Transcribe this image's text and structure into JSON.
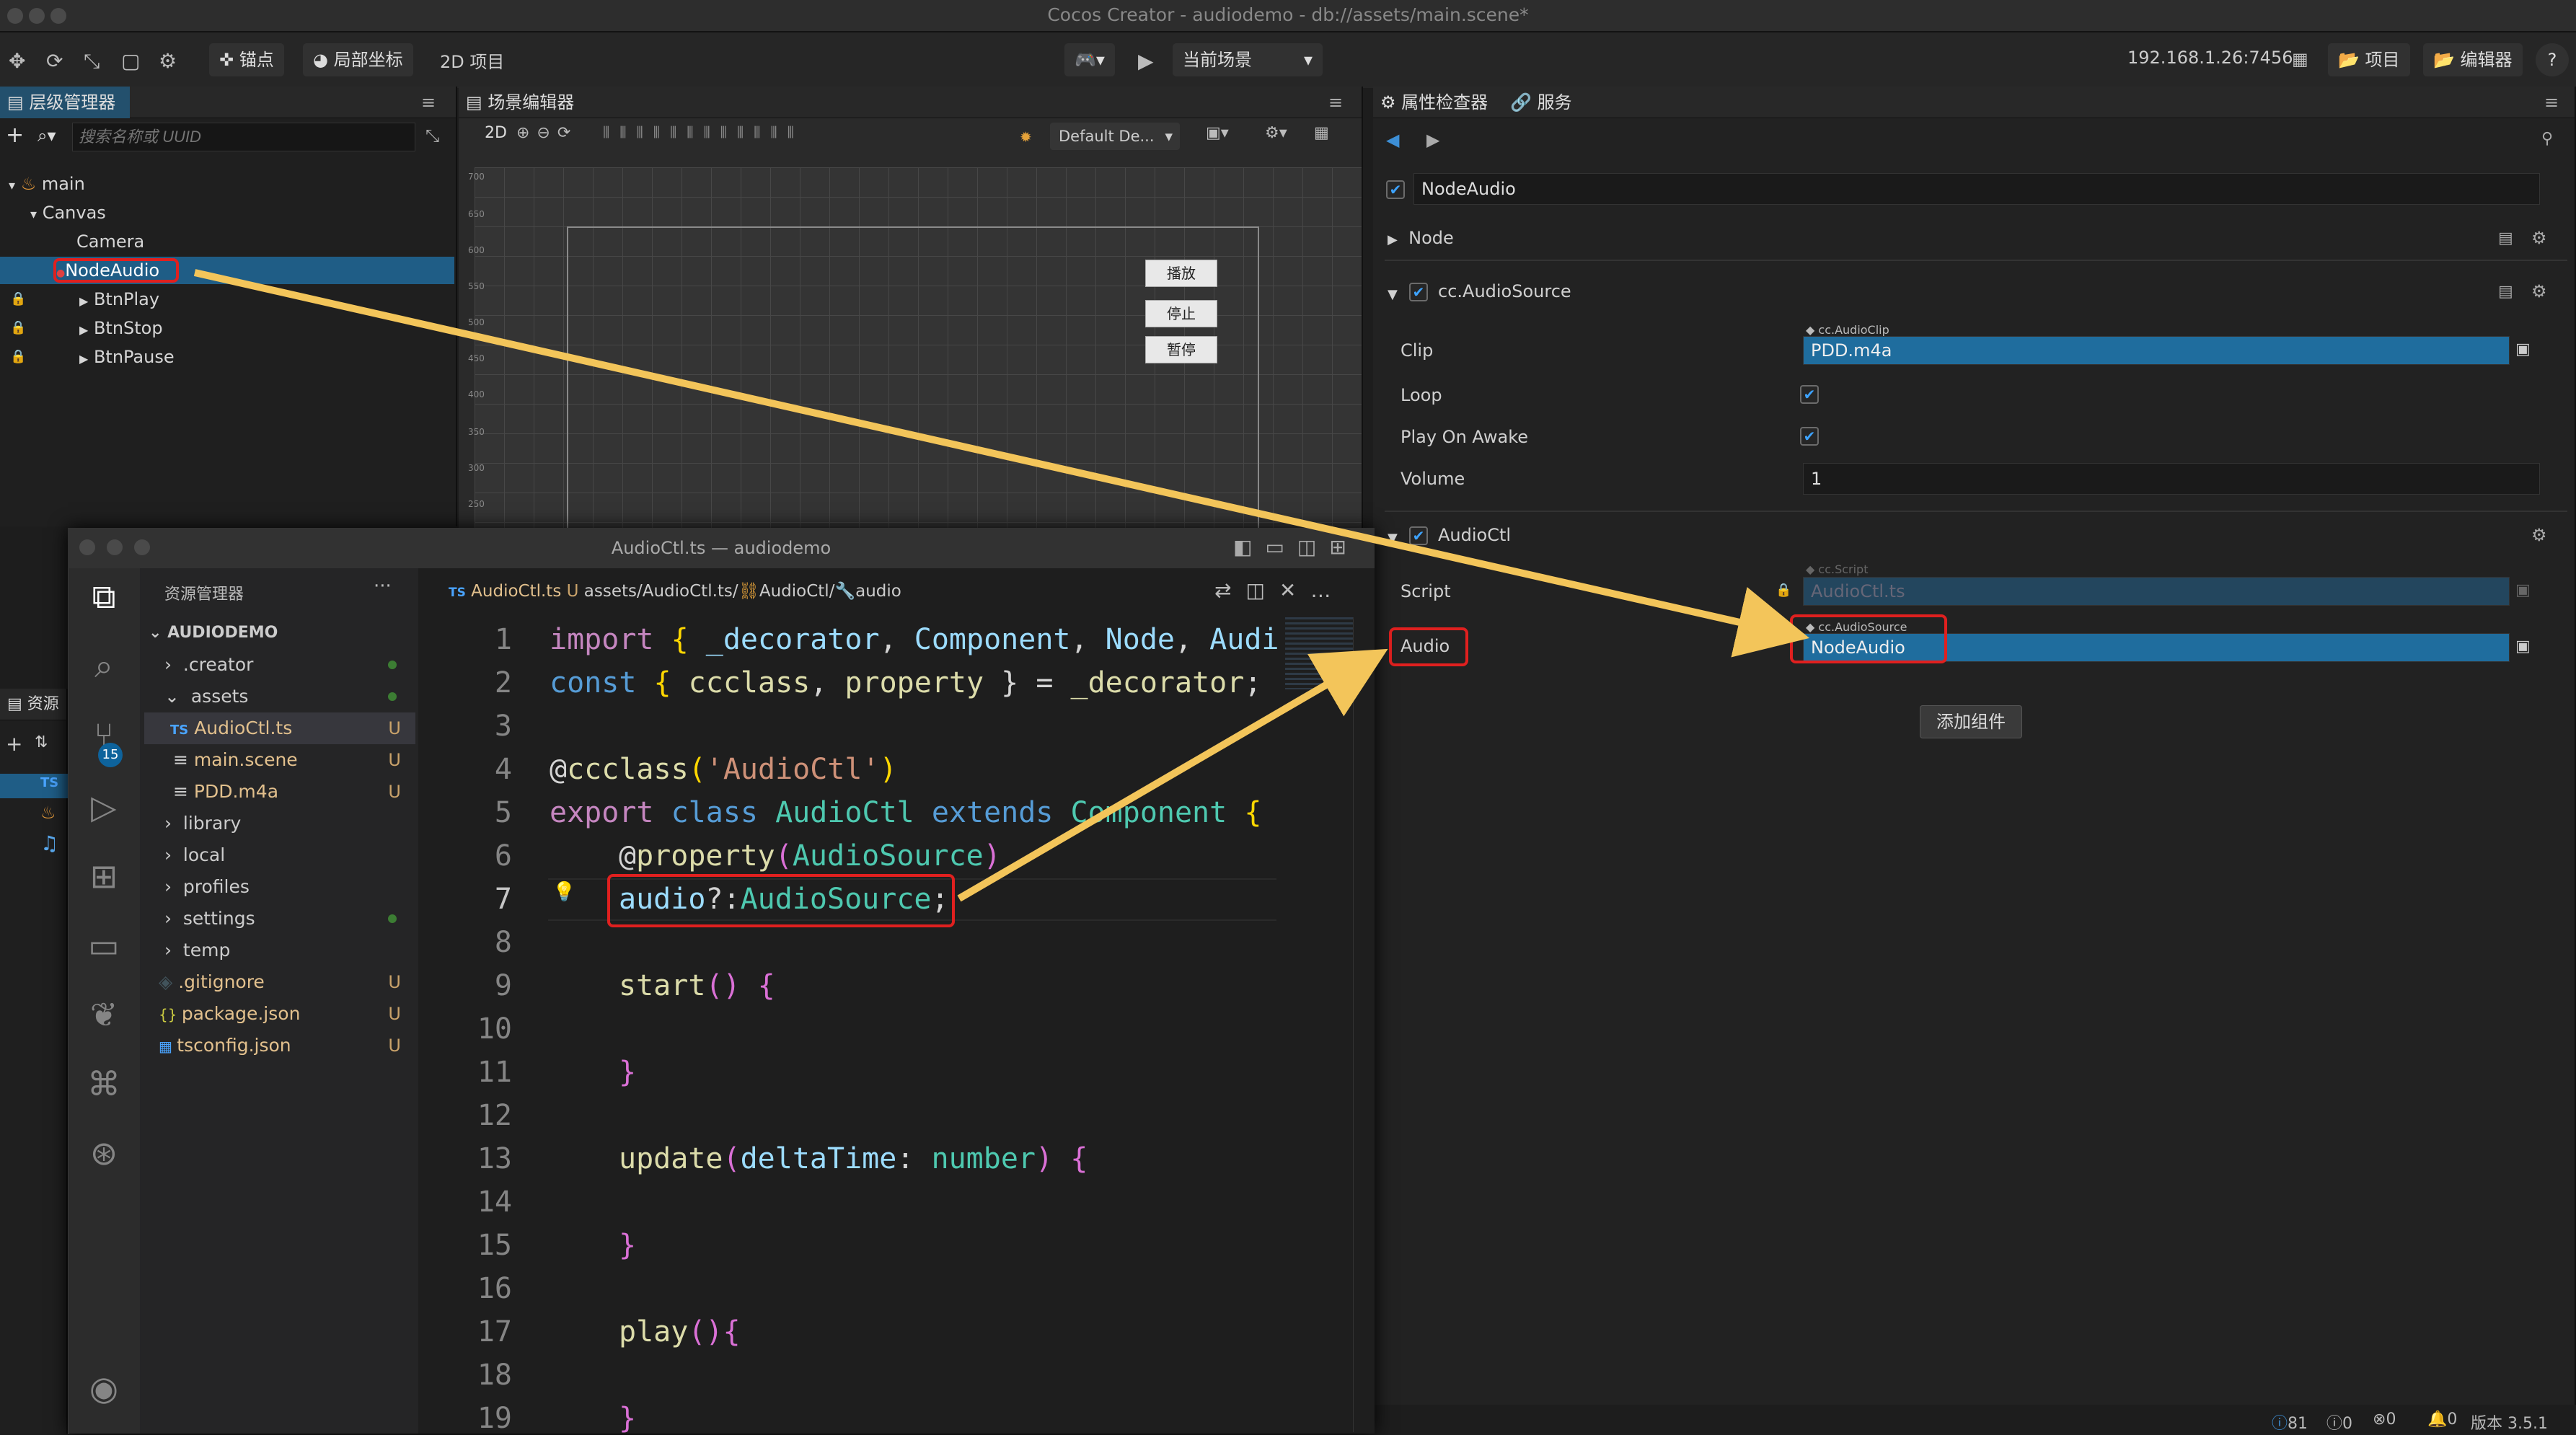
{
  "window_title": "Cocos Creator - audiodemo - db://assets/main.scene*",
  "toolbar": {
    "anchor": "锚点",
    "local_coord": "局部坐标",
    "project_2d": "2D 项目",
    "current_scene": "当前场景",
    "ip": "192.168.1.26:7456",
    "project_btn": "项目",
    "editor_btn": "编辑器",
    "help": "?"
  },
  "hierarchy": {
    "tab": "层级管理器",
    "search_placeholder": "搜索名称或 UUID",
    "items": [
      {
        "label": "main"
      },
      {
        "label": "Canvas"
      },
      {
        "label": "Camera"
      },
      {
        "label": "NodeAudio"
      },
      {
        "label": "BtnPlay"
      },
      {
        "label": "BtnStop"
      },
      {
        "label": "BtnPause"
      }
    ]
  },
  "assets_panel": {
    "tab": "资源"
  },
  "scene": {
    "tab": "场景编辑器",
    "mode": "2D",
    "camera": "Default De...",
    "ruler": [
      "700",
      "650",
      "600",
      "550",
      "500",
      "450",
      "400",
      "350",
      "300",
      "250"
    ],
    "buttons": [
      "播放",
      "停止",
      "暂停"
    ]
  },
  "inspector": {
    "tab": "属性检查器",
    "tab2": "服务",
    "node_name": "NodeAudio",
    "node_section": "Node",
    "audio_source": {
      "title": "cc.AudioSource",
      "clip_label": "Clip",
      "clip_type": "cc.AudioClip",
      "clip_value": "PDD.m4a",
      "loop_label": "Loop",
      "play_on_awake_label": "Play On Awake",
      "volume_label": "Volume",
      "volume_value": "1"
    },
    "audioctl": {
      "title": "AudioCtl",
      "script_label": "Script",
      "script_type": "cc.Script",
      "script_value": "AudioCtl.ts",
      "audio_label": "Audio",
      "audio_type": "cc.AudioSource",
      "audio_value": "NodeAudio"
    },
    "add_component": "添加组件"
  },
  "vscode": {
    "title": "AudioCtl.ts — audiodemo",
    "explorer_title": "资源管理器",
    "root": "AUDIODEMO",
    "badge": "15",
    "files": [
      {
        "name": ".creator",
        "status": ""
      },
      {
        "name": "assets",
        "status": ""
      },
      {
        "name": "AudioCtl.ts",
        "status": "U"
      },
      {
        "name": "main.scene",
        "status": "U"
      },
      {
        "name": "PDD.m4a",
        "status": "U"
      },
      {
        "name": "library",
        "status": ""
      },
      {
        "name": "local",
        "status": ""
      },
      {
        "name": "profiles",
        "status": ""
      },
      {
        "name": "settings",
        "status": ""
      },
      {
        "name": "temp",
        "status": ""
      },
      {
        "name": ".gitignore",
        "status": "U"
      },
      {
        "name": "package.json",
        "status": "U"
      },
      {
        "name": "tsconfig.json",
        "status": "U"
      }
    ],
    "tab_file": "AudioCtl.ts",
    "tab_status": "U",
    "breadcrumb": "assets/AudioCtl.ts/",
    "breadcrumb_class": "AudioCtl/",
    "breadcrumb_prop": "audio",
    "line_numbers": [
      "1",
      "2",
      "3",
      "4",
      "5",
      "6",
      "7",
      "8",
      "9",
      "10",
      "11",
      "12",
      "13",
      "14",
      "15",
      "16",
      "17",
      "18",
      "19"
    ],
    "code": {
      "l1a": "import",
      "l1b": " { ",
      "l1c": "_decorator",
      "l1d": ", ",
      "l1e": "Component",
      "l1f": ", ",
      "l1g": "Node",
      "l1h": ", ",
      "l1i": "Audi",
      "l2a": "const",
      "l2b": " { ",
      "l2c": "ccclass",
      "l2d": ", ",
      "l2e": "property",
      "l2f": " } = ",
      "l2g": "_decorator",
      "l2h": ";",
      "l4a": "@",
      "l4b": "ccclass",
      "l4c": "(",
      "l4d": "'AudioCtl'",
      "l4e": ")",
      "l5a": "export",
      "l5b": " class ",
      "l5c": "AudioCtl",
      "l5d": " extends ",
      "l5e": "Component",
      "l5f": " {",
      "l6a": "@",
      "l6b": "property",
      "l6c": "(",
      "l6d": "AudioSource",
      "l6e": ")",
      "l7a": "audio",
      "l7b": "?:",
      "l7c": "AudioSource",
      "l7d": ";",
      "l9a": "start",
      "l9b": "() ",
      "l9c": "{",
      "l11": "}",
      "l13a": "update",
      "l13b": "(",
      "l13c": "deltaTime",
      "l13d": ": ",
      "l13e": "number",
      "l13f": ") ",
      "l13g": "{",
      "l15": "}",
      "l17a": "play",
      "l17b": "(){",
      "l19": "}"
    }
  },
  "status": {
    "info": "81",
    "warn": "0",
    "err": "0",
    "bell": "0",
    "version": "版本 3.5.1"
  }
}
